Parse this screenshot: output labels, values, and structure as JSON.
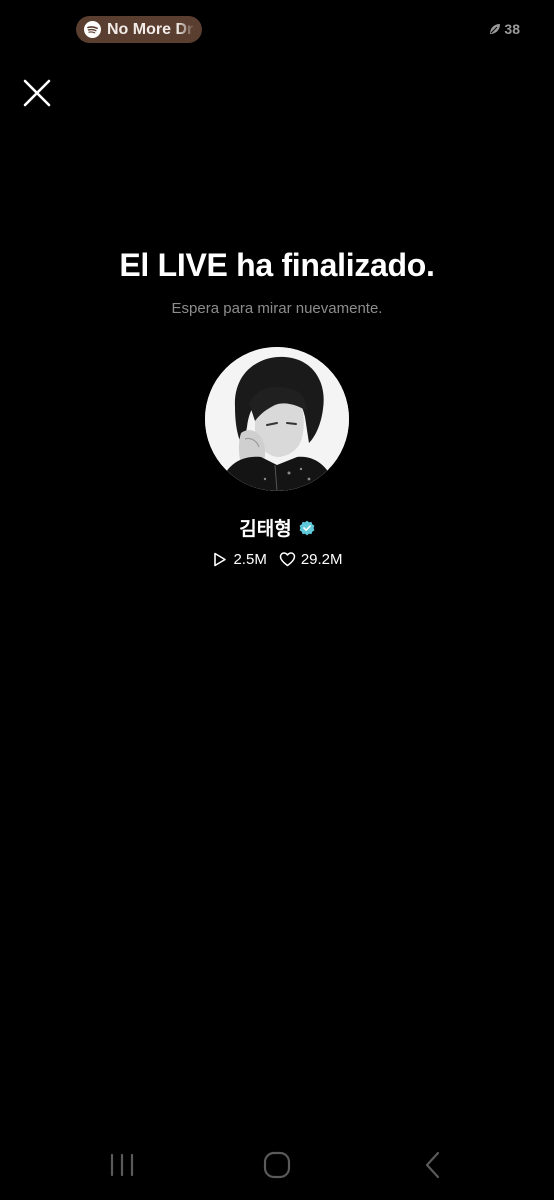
{
  "status_bar": {
    "media_track": "No More Dream",
    "battery_level": "38",
    "icons": [
      "spotify-icon",
      "leaf-icon"
    ]
  },
  "close_icon": "close-icon",
  "live_ended": {
    "title": "El LIVE ha finalizado.",
    "subtitle": "Espera para mirar nuevamente."
  },
  "profile": {
    "name": "김태형",
    "verified": true,
    "verified_color": "#5fc8d9",
    "plays": "2.5M",
    "likes": "29.2M"
  },
  "nav_bar": {
    "icons": [
      "recents-icon",
      "home-icon",
      "back-icon"
    ]
  },
  "colors": {
    "background": "#000000",
    "subtitle": "#8c8c8c",
    "media_pill": "#5a3e30"
  }
}
